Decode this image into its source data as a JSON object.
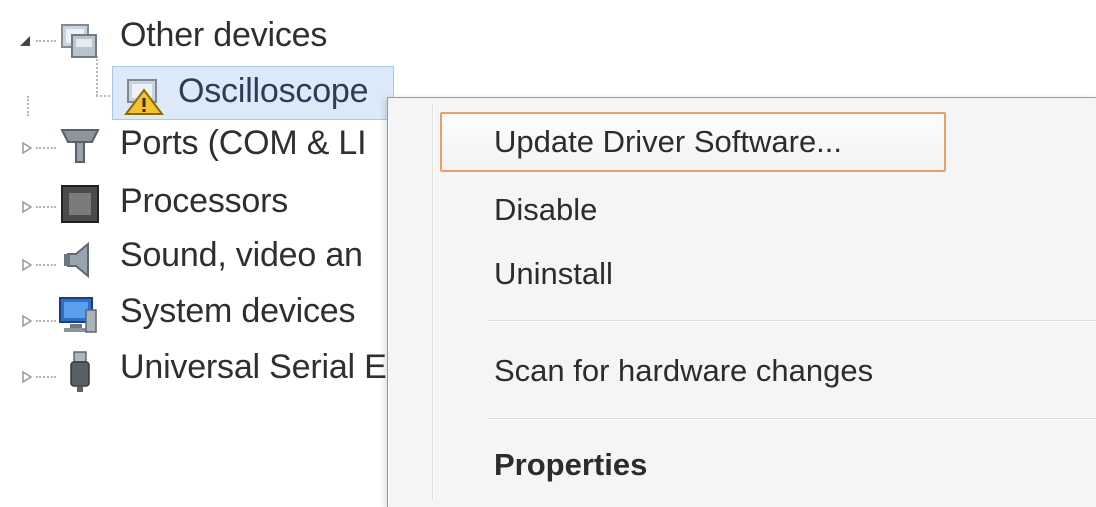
{
  "tree": {
    "other_devices": {
      "label": "Other devices",
      "icon": "unknown-device-icon"
    },
    "oscilloscope": {
      "label": "Oscilloscope",
      "icon": "warning-device-icon"
    },
    "ports": {
      "label": "Ports (COM & LI",
      "icon": "port-connector-icon"
    },
    "processors": {
      "label": "Processors",
      "icon": "processor-chip-icon"
    },
    "sound": {
      "label": "Sound, video an",
      "icon": "speaker-icon"
    },
    "system": {
      "label": "System devices",
      "icon": "computer-monitor-icon"
    },
    "usb": {
      "label": "Universal Serial E",
      "icon": "usb-plug-icon"
    }
  },
  "context_menu": {
    "update": "Update Driver Software...",
    "disable": "Disable",
    "uninstall": "Uninstall",
    "scan": "Scan for hardware changes",
    "properties": "Properties"
  },
  "colors": {
    "menu_highlight_border": "#e8a06a",
    "selection_fill": "#dbe9f8",
    "selection_border": "#a9c9ec"
  }
}
